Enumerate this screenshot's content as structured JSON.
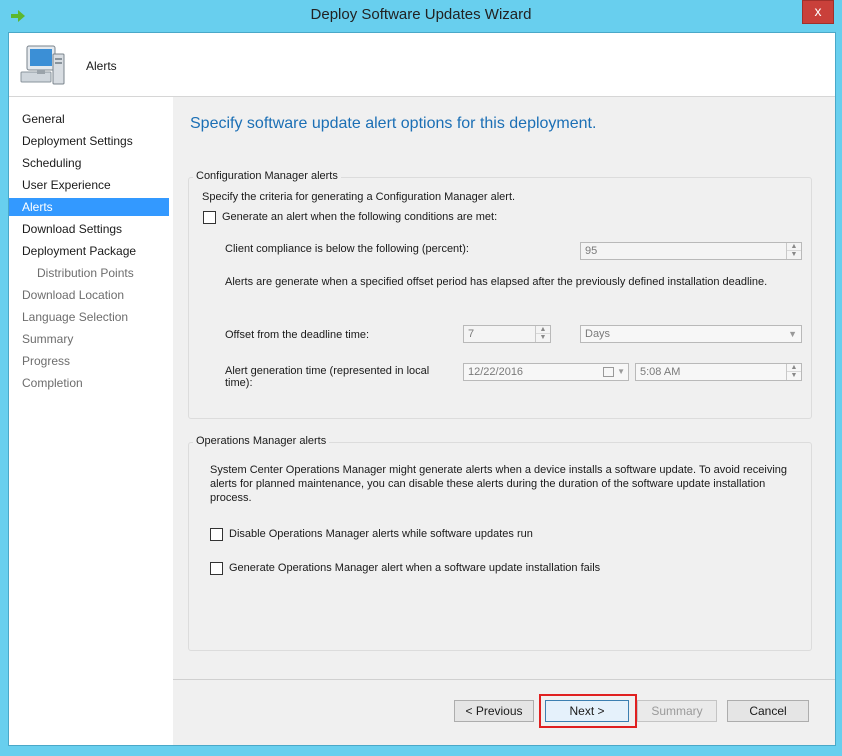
{
  "window": {
    "title": "Deploy Software Updates Wizard",
    "close_label": "x"
  },
  "header": {
    "title": "Alerts",
    "icon": "computer-icon"
  },
  "sidebar": {
    "items": [
      {
        "label": "General"
      },
      {
        "label": "Deployment Settings"
      },
      {
        "label": "Scheduling"
      },
      {
        "label": "User Experience"
      },
      {
        "label": "Alerts"
      },
      {
        "label": "Download Settings"
      },
      {
        "label": "Deployment Package"
      },
      {
        "label": "Distribution Points"
      },
      {
        "label": "Download Location"
      },
      {
        "label": "Language Selection"
      },
      {
        "label": "Summary"
      },
      {
        "label": "Progress"
      },
      {
        "label": "Completion"
      }
    ]
  },
  "main": {
    "heading": "Specify software update alert options for this deployment.",
    "cm_group": {
      "title": "Configuration Manager alerts",
      "description": "Specify the criteria for generating a Configuration Manager alert.",
      "generate_alert_label": "Generate an alert when the following conditions are met:",
      "generate_alert_checked": false,
      "compliance_label": "Client compliance is below the following (percent):",
      "compliance_value": "95",
      "offset_info": "Alerts are generate when a specified offset period has elapsed after the previously defined installation deadline.",
      "offset_label": "Offset from the deadline time:",
      "offset_value": "7",
      "offset_unit": "Days",
      "gen_time_label": "Alert generation time (represented in local time):",
      "gen_date": "12/22/2016",
      "gen_time": "5:08 AM"
    },
    "om_group": {
      "title": "Operations Manager alerts",
      "description": "System Center Operations Manager might generate alerts when a device installs a software update. To avoid receiving alerts for planned maintenance, you can disable these alerts during the duration of the software update installation process.",
      "disable_label": "Disable Operations Manager alerts while software updates run",
      "disable_checked": false,
      "generate_label": "Generate Operations Manager alert when a software update installation fails",
      "generate_checked": false
    }
  },
  "buttons": {
    "previous": "< Previous",
    "next": "Next >",
    "summary": "Summary",
    "cancel": "Cancel"
  },
  "colors": {
    "frame": "#68cfee",
    "heading": "#1b6fb5",
    "nav_selected": "#3399ff",
    "highlight": "#e02020"
  }
}
